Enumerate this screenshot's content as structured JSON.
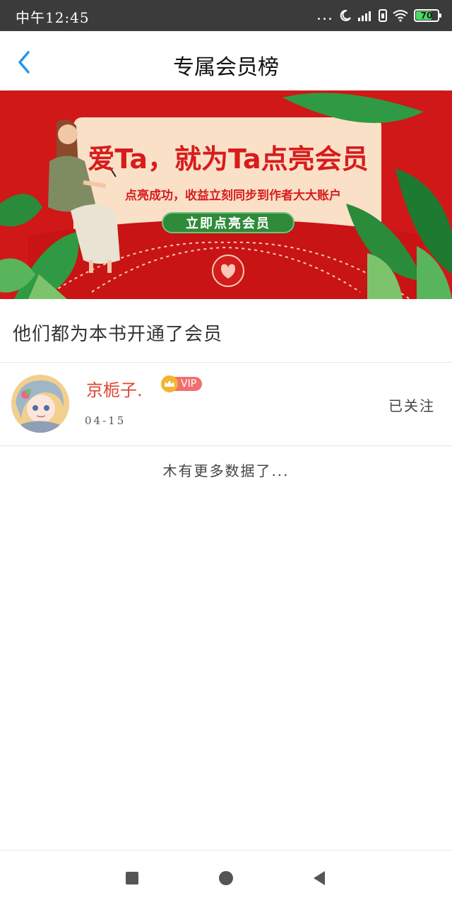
{
  "status_bar": {
    "time": "中午12:45",
    "dots": "...",
    "battery_level": "70"
  },
  "header": {
    "title": "专属会员榜"
  },
  "banner": {
    "headline": "爱Ta，就为Ta点亮会员",
    "subtitle": "点亮成功，收益立刻同步到作者大大账户",
    "cta_label": "立即点亮会员"
  },
  "section": {
    "title": "他们都为本书开通了会员"
  },
  "members": [
    {
      "name": "京栀子.",
      "vip_label": "VIP",
      "date": "04-15",
      "follow_status": "已关注"
    }
  ],
  "footer_note": "木有更多数据了...",
  "colors": {
    "accent_blue": "#2196f3",
    "banner_red": "#d01818",
    "cta_green": "#2f8a3a",
    "name_red": "#e04434"
  }
}
